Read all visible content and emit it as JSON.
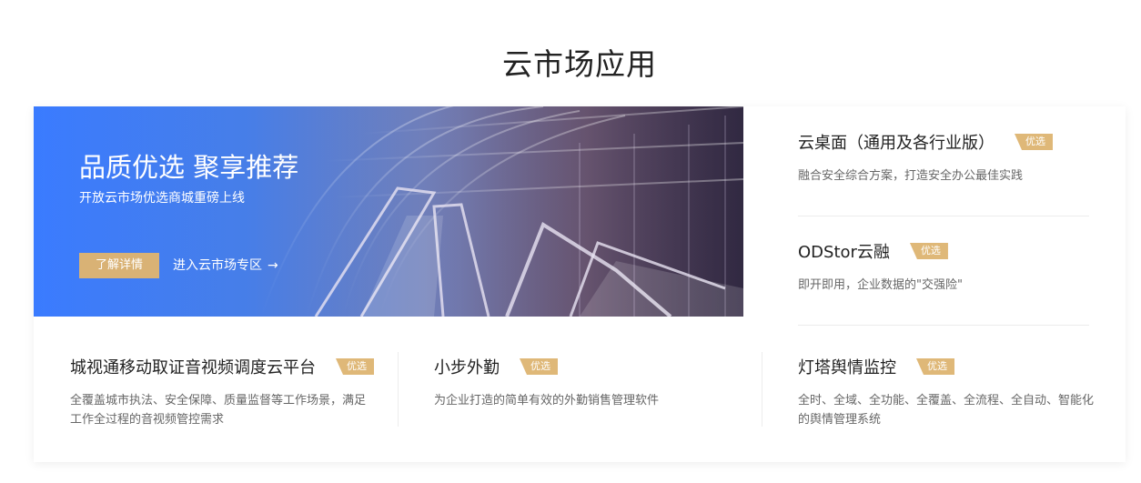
{
  "section": {
    "title": "云市场应用"
  },
  "banner": {
    "title": "品质优选 聚享推荐",
    "subtitle": "开放云市场优选商城重磅上线",
    "details_button": "了解详情",
    "zone_link": "进入云市场专区",
    "zone_arrow": "→"
  },
  "badge_label": "优选",
  "right_items": [
    {
      "title": "云桌面（通用及各行业版）",
      "desc": "融合安全综合方案，打造安全办公最佳实践"
    },
    {
      "title": "ODStor云融",
      "desc": "即开即用，企业数据的\"交强险\""
    }
  ],
  "bottom_items": [
    {
      "title": "城视通移动取证音视频调度云平台",
      "desc": "全覆盖城市执法、安全保障、质量监督等工作场景，满足工作全过程的音视频管控需求"
    },
    {
      "title": "小步外勤",
      "desc": "为企业打造的简单有效的外勤销售管理软件"
    },
    {
      "title": "灯塔舆情监控",
      "desc": "全时、全域、全功能、全覆盖、全流程、全自动、智能化的舆情管理系统"
    }
  ],
  "colors": {
    "accent_gold": "#d9b275",
    "banner_blue": "#3a7bff"
  }
}
